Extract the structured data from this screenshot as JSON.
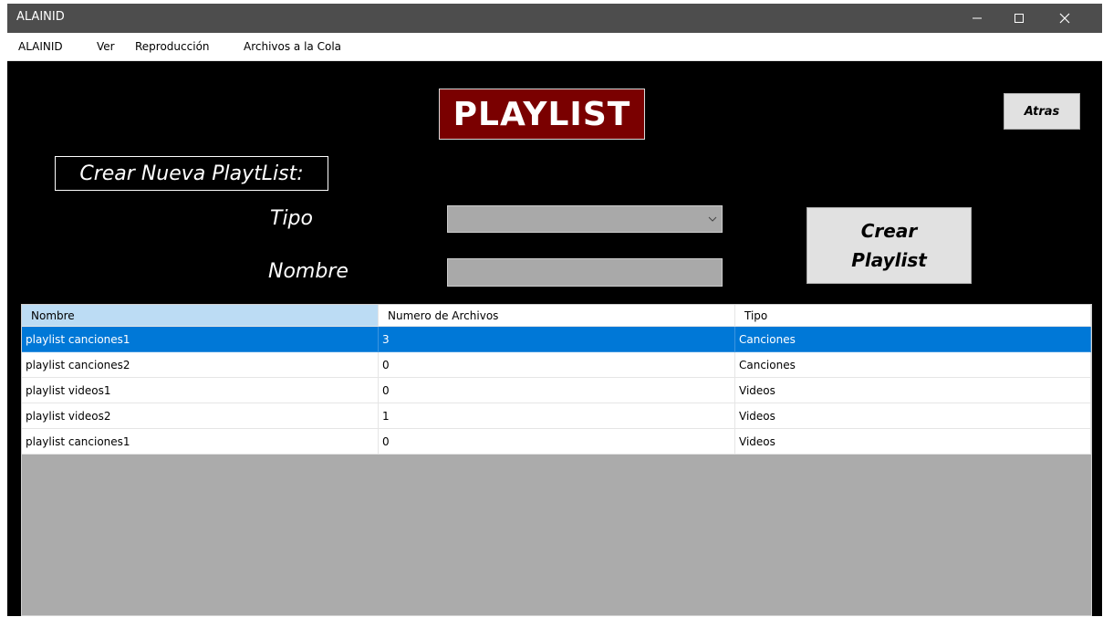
{
  "window": {
    "title": "ALAINID"
  },
  "menu": [
    "ALAINID",
    "Ver",
    "Reproducción",
    "Archivos a la Cola"
  ],
  "header": {
    "title": "PLAYLIST",
    "back_label": "Atras"
  },
  "form": {
    "section_label": "Crear Nueva PlaytList:",
    "tipo_label": "Tipo",
    "tipo_value": "",
    "nombre_label": "Nombre",
    "nombre_value": "",
    "create_line1": "Crear",
    "create_line2": "Playlist"
  },
  "table": {
    "columns": [
      "Nombre",
      "Numero de Archivos",
      "Tipo"
    ],
    "rows": [
      [
        "playlist canciones1",
        "3",
        "Canciones"
      ],
      [
        "playlist canciones2",
        "0",
        "Canciones"
      ],
      [
        "playlist videos1",
        "0",
        "Videos"
      ],
      [
        "playlist videos2",
        "1",
        "Videos"
      ],
      [
        "playlist canciones1",
        "0",
        "Videos"
      ]
    ],
    "selected_row": 0
  },
  "colors": {
    "title_bg": "#7a0000",
    "selection": "#0078d7",
    "header_active": "#bcdcf4",
    "grid_bg": "#ababab"
  },
  "icons": [
    "minimize-icon",
    "maximize-icon",
    "close-icon",
    "chevron-down-icon"
  ]
}
